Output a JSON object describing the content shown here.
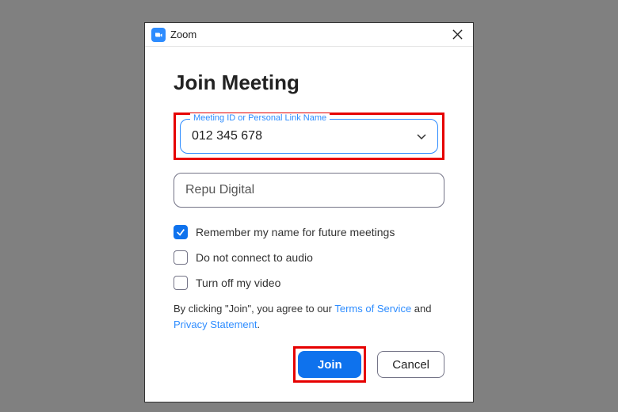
{
  "window": {
    "title": "Zoom"
  },
  "heading": "Join Meeting",
  "meeting_field": {
    "label": "Meeting ID or Personal Link Name",
    "value": "012 345 678"
  },
  "name_field": {
    "value": "Repu Digital"
  },
  "checkboxes": {
    "remember": {
      "label": "Remember my name for future meetings",
      "checked": true
    },
    "no_audio": {
      "label": "Do not connect to audio",
      "checked": false
    },
    "no_video": {
      "label": "Turn off my video",
      "checked": false
    }
  },
  "legal": {
    "prefix": "By clicking \"Join\", you agree to our ",
    "tos": "Terms of Service",
    "middle": " and ",
    "privacy": "Privacy Statement",
    "suffix": "."
  },
  "buttons": {
    "join": "Join",
    "cancel": "Cancel"
  }
}
